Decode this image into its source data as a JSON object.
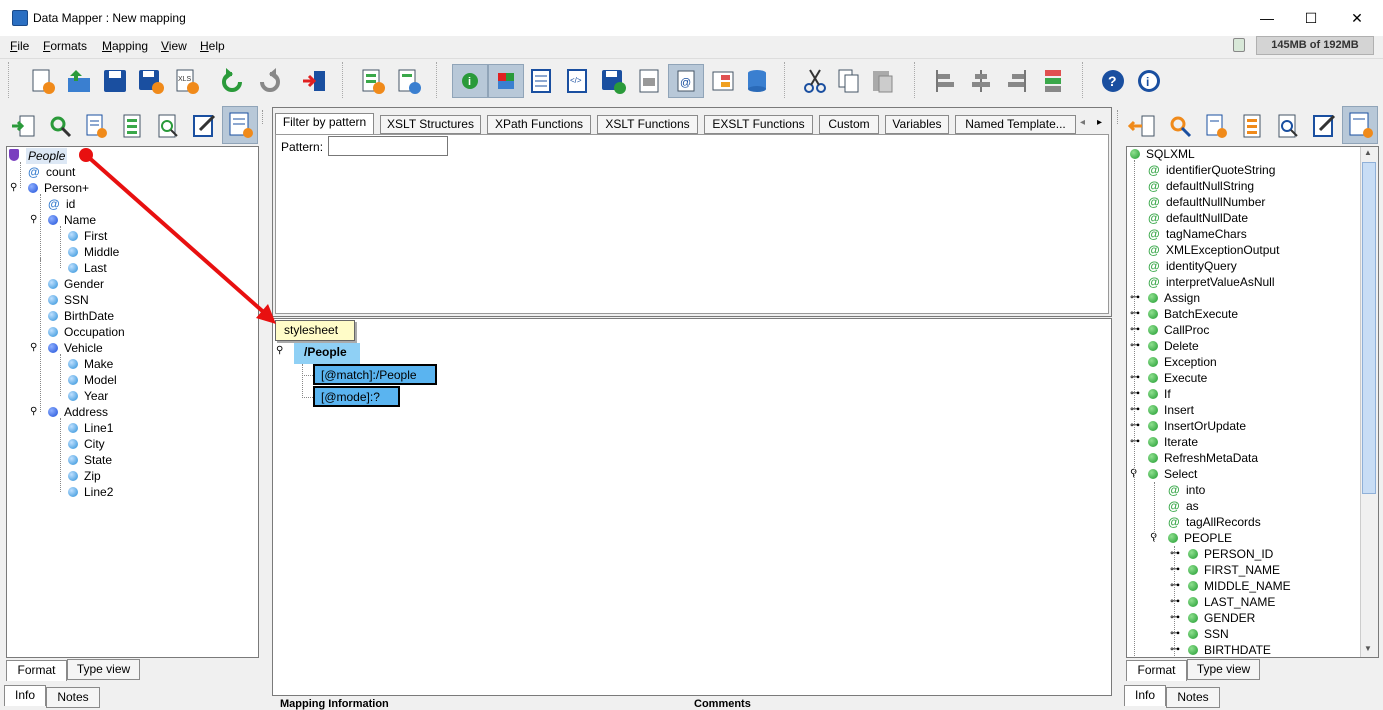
{
  "window": {
    "title": "Data Mapper : New mapping",
    "min": "—",
    "max": "☐",
    "close": "✕"
  },
  "menu": [
    "File",
    "Formats",
    "Mapping",
    "View",
    "Help"
  ],
  "memory": "145MB of 192MB",
  "left_tree": {
    "root": "People",
    "items": [
      {
        "label": "count",
        "kind": "attr"
      },
      {
        "label": "Person+",
        "kind": "elem"
      },
      {
        "label": "id",
        "kind": "attr"
      },
      {
        "label": "Name",
        "kind": "elem"
      },
      {
        "label": "First",
        "kind": "leaf"
      },
      {
        "label": "Middle",
        "kind": "leaf"
      },
      {
        "label": "Last",
        "kind": "leaf"
      },
      {
        "label": "Gender",
        "kind": "leaf"
      },
      {
        "label": "SSN",
        "kind": "leaf"
      },
      {
        "label": "BirthDate",
        "kind": "leaf"
      },
      {
        "label": "Occupation",
        "kind": "leaf"
      },
      {
        "label": "Vehicle",
        "kind": "elem"
      },
      {
        "label": "Make",
        "kind": "leaf"
      },
      {
        "label": "Model",
        "kind": "leaf"
      },
      {
        "label": "Year",
        "kind": "leaf"
      },
      {
        "label": "Address",
        "kind": "elem"
      },
      {
        "label": "Line1",
        "kind": "leaf"
      },
      {
        "label": "City",
        "kind": "leaf"
      },
      {
        "label": "State",
        "kind": "leaf"
      },
      {
        "label": "Zip",
        "kind": "leaf"
      },
      {
        "label": "Line2",
        "kind": "leaf"
      }
    ],
    "tabs": [
      "Format",
      "Type view"
    ]
  },
  "bottom_left_tabs": [
    "Info",
    "Notes"
  ],
  "center": {
    "tabs": [
      "Filter by pattern",
      "XSLT Structures",
      "XPath Functions",
      "XSLT Functions",
      "EXSLT Functions",
      "Custom",
      "Variables",
      "Named Template..."
    ],
    "pattern_label": "Pattern:",
    "pattern_value": "",
    "stylesheet_label": "stylesheet",
    "template_root": "/People",
    "template_attrs": [
      "[@match]:/People",
      "[@mode]:?"
    ],
    "bottom_labels": [
      "Mapping Information",
      "Comments"
    ]
  },
  "right_tree": {
    "root": "SQLXML",
    "items": [
      {
        "label": "identifierQuoteString",
        "kind": "attr"
      },
      {
        "label": "defaultNullString",
        "kind": "attr"
      },
      {
        "label": "defaultNullNumber",
        "kind": "attr"
      },
      {
        "label": "defaultNullDate",
        "kind": "attr"
      },
      {
        "label": "tagNameChars",
        "kind": "attr"
      },
      {
        "label": "XMLExceptionOutput",
        "kind": "attr"
      },
      {
        "label": "identityQuery",
        "kind": "attr"
      },
      {
        "label": "interpretValueAsNull",
        "kind": "attr"
      },
      {
        "label": "Assign",
        "kind": "node"
      },
      {
        "label": "BatchExecute",
        "kind": "node"
      },
      {
        "label": "CallProc",
        "kind": "node"
      },
      {
        "label": "Delete",
        "kind": "node"
      },
      {
        "label": "Exception",
        "kind": "leaf"
      },
      {
        "label": "Execute",
        "kind": "node"
      },
      {
        "label": "If",
        "kind": "node"
      },
      {
        "label": "Insert",
        "kind": "node"
      },
      {
        "label": "InsertOrUpdate",
        "kind": "node"
      },
      {
        "label": "Iterate",
        "kind": "node"
      },
      {
        "label": "RefreshMetaData",
        "kind": "leaf"
      },
      {
        "label": "Select",
        "kind": "open"
      },
      {
        "label": "into",
        "kind": "attr2"
      },
      {
        "label": "as",
        "kind": "attr2"
      },
      {
        "label": "tagAllRecords",
        "kind": "attr2"
      },
      {
        "label": "PEOPLE",
        "kind": "open2"
      },
      {
        "label": "PERSON_ID",
        "kind": "col"
      },
      {
        "label": "FIRST_NAME",
        "kind": "col"
      },
      {
        "label": "MIDDLE_NAME",
        "kind": "col"
      },
      {
        "label": "LAST_NAME",
        "kind": "col"
      },
      {
        "label": "GENDER",
        "kind": "col"
      },
      {
        "label": "SSN",
        "kind": "col"
      },
      {
        "label": "BIRTHDATE",
        "kind": "col"
      }
    ],
    "tabs": [
      "Format",
      "Type view"
    ]
  },
  "bottom_right_tabs": [
    "Info",
    "Notes"
  ],
  "colors": {
    "arrow": "#e81010",
    "node_blue": "#5ab4f0",
    "stylesheet_bg": "#fffcc8"
  }
}
